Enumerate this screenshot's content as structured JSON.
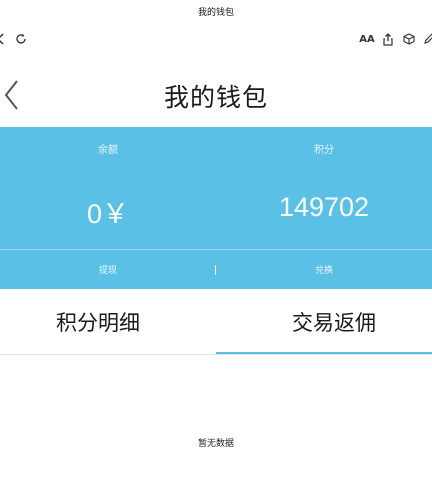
{
  "status_bar": {
    "title": "我的钱包"
  },
  "browser": {
    "reader_label": "AA",
    "icons": [
      "back-arrow-icon",
      "refresh-icon",
      "reader-icon",
      "share-icon",
      "package-icon",
      "pen-icon"
    ]
  },
  "header": {
    "title": "我的钱包"
  },
  "wallet": {
    "balance_label": "余额",
    "balance_value": "0￥",
    "points_label": "积分",
    "points_value": "149702",
    "withdraw_label": "提现",
    "separator": "|",
    "exchange_label": "兑换"
  },
  "tabs": [
    {
      "label": "积分明细",
      "active": false
    },
    {
      "label": "交易返佣",
      "active": true
    }
  ],
  "empty_state": {
    "text": "暂无数据"
  },
  "colors": {
    "accent": "#5bc0e6",
    "panel_text": "#ffffff"
  }
}
